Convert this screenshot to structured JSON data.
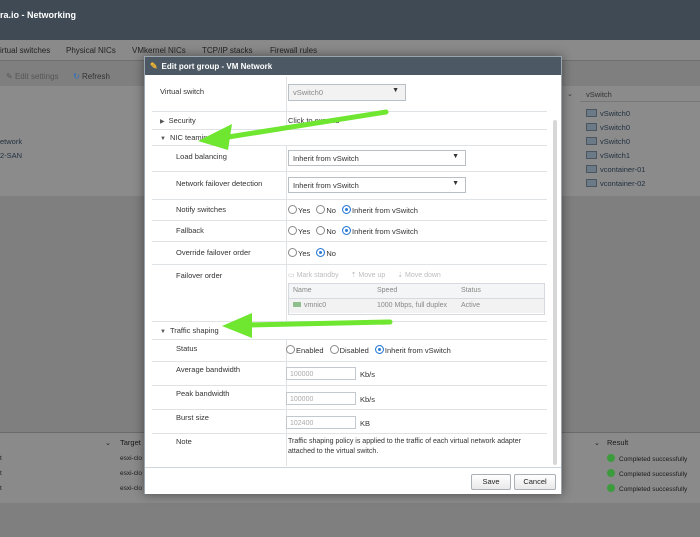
{
  "app": {
    "title": "ra.io - Networking",
    "tabs": [
      "irtual switches",
      "Physical NICs",
      "VMkernel NICs",
      "TCP/IP stacks",
      "Firewall rules"
    ],
    "toolbar": {
      "edit": "Edit settings",
      "refresh": "Refresh"
    },
    "grid": {
      "col_vswitch": "vSwitch",
      "left_items": [
        "etwork",
        "2-SAN"
      ],
      "vswitch_values": [
        "vSwitch0",
        "vSwitch0",
        "vSwitch0",
        "vSwitch1",
        "vcontainer-01",
        "vcontainer-02"
      ]
    },
    "tasks": {
      "col_target": "Target",
      "col_result": "Result",
      "target_values": [
        "esxi-clo",
        "esxi-clo",
        "esxi-clo"
      ],
      "left_values": [
        "t",
        "t",
        "t"
      ],
      "results": [
        "Completed successfully",
        "Completed successfully",
        "Completed successfully"
      ]
    }
  },
  "dialog": {
    "title": "Edit port group - VM Network",
    "virtual_switch": {
      "label": "Virtual switch",
      "value": "vSwitch0"
    },
    "security": {
      "label": "Security",
      "value": "Click to expand"
    },
    "nic_teaming": {
      "label": "NIC teaming",
      "load_balancing": {
        "label": "Load balancing",
        "value": "Inherit from vSwitch"
      },
      "failover_detection": {
        "label": "Network failover detection",
        "value": "Inherit from vSwitch"
      },
      "notify_switches": {
        "label": "Notify switches",
        "options": [
          "Yes",
          "No",
          "Inherit from vSwitch"
        ],
        "selected": "Inherit from vSwitch"
      },
      "fallback": {
        "label": "Fallback",
        "options": [
          "Yes",
          "No",
          "Inherit from vSwitch"
        ],
        "selected": "Inherit from vSwitch"
      },
      "override_failover": {
        "label": "Override failover order",
        "options": [
          "Yes",
          "No"
        ],
        "selected": "No"
      },
      "failover_order": {
        "label": "Failover order",
        "tools": [
          "Mark standby",
          "Move up",
          "Move down"
        ],
        "columns": [
          "Name",
          "Speed",
          "Status"
        ],
        "rows": [
          {
            "name": "vmnic0",
            "speed": "1000 Mbps, full duplex",
            "status": "Active"
          }
        ]
      }
    },
    "traffic_shaping": {
      "label": "Traffic shaping",
      "status": {
        "label": "Status",
        "options": [
          "Enabled",
          "Disabled",
          "Inherit from vSwitch"
        ],
        "selected": "Inherit from vSwitch"
      },
      "average_bandwidth": {
        "label": "Average bandwidth",
        "placeholder": "100000",
        "unit": "Kb/s"
      },
      "peak_bandwidth": {
        "label": "Peak bandwidth",
        "placeholder": "100000",
        "unit": "Kb/s"
      },
      "burst_size": {
        "label": "Burst size",
        "placeholder": "102400",
        "unit": "KB"
      },
      "note": {
        "label": "Note",
        "line1": "Traffic shaping policy is applied to the traffic of each virtual network adapter",
        "line2": "attached to the virtual switch."
      }
    },
    "buttons": {
      "save": "Save",
      "cancel": "Cancel"
    }
  },
  "colors": {
    "accent": "#2a7bd6",
    "annotation_arrow": "#6fe62f",
    "titlebar": "#4c5964"
  }
}
